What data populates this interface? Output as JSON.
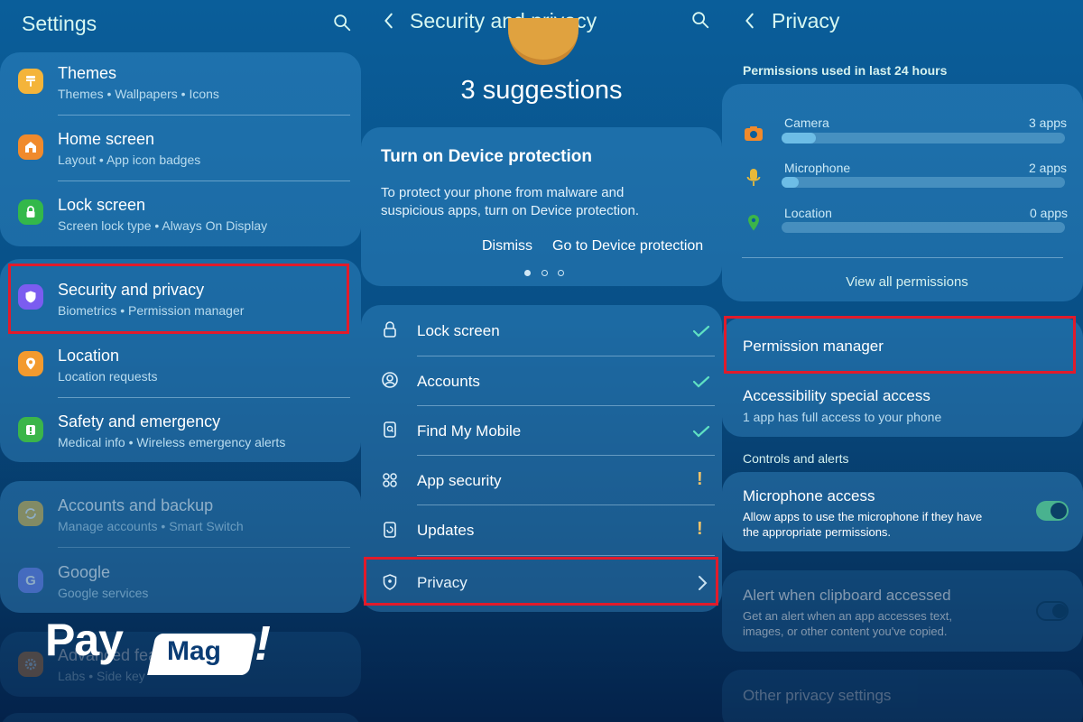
{
  "settings": {
    "title": "Settings",
    "items": [
      {
        "title": "Themes",
        "subtitle": "Themes  •  Wallpapers  •  Icons",
        "icon": "brush-icon",
        "color": "#f4b43a"
      },
      {
        "title": "Home screen",
        "subtitle": "Layout  •  App icon badges",
        "icon": "home-icon",
        "color": "#f08a2c"
      },
      {
        "title": "Lock screen",
        "subtitle": "Screen lock type  •  Always On Display",
        "icon": "lock-icon",
        "color": "#33b84a"
      },
      {
        "title": "Security and privacy",
        "subtitle": "Biometrics  •  Permission manager",
        "icon": "shield-icon",
        "color": "#7b5cf0"
      },
      {
        "title": "Location",
        "subtitle": "Location requests",
        "icon": "location-pin-icon",
        "color": "#f39a2e"
      },
      {
        "title": "Safety and emergency",
        "subtitle": "Medical info  •  Wireless emergency alerts",
        "icon": "emergency-icon",
        "color": "#3bb54a"
      },
      {
        "title": "Accounts and backup",
        "subtitle": "Manage accounts  •  Smart Switch",
        "icon": "sync-icon",
        "color": "#e9b93a"
      },
      {
        "title": "Google",
        "subtitle": "Google services",
        "icon": "google-icon",
        "color": "#6e7df2"
      },
      {
        "title": "Advanced features",
        "subtitle": "Labs  •  Side key",
        "icon": "gear-icon",
        "color": "#f08a2c"
      }
    ]
  },
  "security": {
    "title": "Security and privacy",
    "suggestions": "3 suggestions",
    "card_title": "Turn on Device protection",
    "card_body_1": "To protect your phone from malware and",
    "card_body_2": "suspicious apps, turn on Device protection.",
    "dismiss": "Dismiss",
    "go": "Go to Device protection",
    "items": [
      {
        "label": "Lock screen",
        "status": "ok",
        "icon": "lock-outline-icon"
      },
      {
        "label": "Accounts",
        "status": "ok",
        "icon": "account-circle-icon"
      },
      {
        "label": "Find My Mobile",
        "status": "ok",
        "icon": "find-mobile-icon"
      },
      {
        "label": "App security",
        "status": "warn",
        "icon": "apps-grid-icon"
      },
      {
        "label": "Updates",
        "status": "warn",
        "icon": "update-icon"
      },
      {
        "label": "Privacy",
        "status": "nav",
        "icon": "privacy-shield-icon"
      }
    ]
  },
  "privacy": {
    "title": "Privacy",
    "used_header": "Permissions used in last 24 hours",
    "permissions": [
      {
        "label": "Camera",
        "count": "3 apps",
        "fill": 0.12,
        "icon": "camera-icon",
        "color": "#f08a2c"
      },
      {
        "label": "Microphone",
        "count": "2 apps",
        "fill": 0.06,
        "icon": "microphone-icon",
        "color": "#e8b93a"
      },
      {
        "label": "Location",
        "count": "0 apps",
        "fill": 0.0,
        "icon": "location-pin-icon",
        "color": "#3bb54a"
      }
    ],
    "view_all": "View all permissions",
    "permission_manager": "Permission manager",
    "accessibility_title": "Accessibility special access",
    "accessibility_sub": "1 app has full access to your phone",
    "controls_header": "Controls and alerts",
    "mic_title": "Microphone access",
    "mic_sub_1": "Allow apps to use the microphone if they have",
    "mic_sub_2": "the appropriate permissions.",
    "mic_on": true,
    "clip_title": "Alert when clipboard accessed",
    "clip_sub_1": "Get an alert when an app accesses text,",
    "clip_sub_2": "images, or other content you've copied.",
    "clip_on": false,
    "other": "Other privacy settings"
  },
  "logo": {
    "left": "Pay",
    "badge": "Mag",
    "right": "!"
  },
  "colors": {
    "highlight": "#e11b2b",
    "accent": "#5fe0c3",
    "warn": "#f0c36a"
  }
}
